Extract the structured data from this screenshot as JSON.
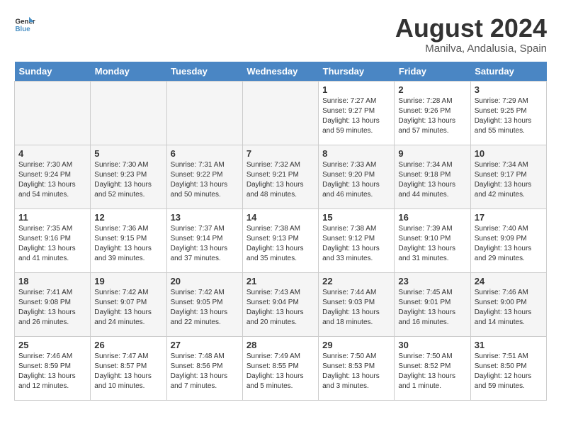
{
  "header": {
    "logo_line1": "General",
    "logo_line2": "Blue",
    "month_year": "August 2024",
    "location": "Manilva, Andalusia, Spain"
  },
  "days_of_week": [
    "Sunday",
    "Monday",
    "Tuesday",
    "Wednesday",
    "Thursday",
    "Friday",
    "Saturday"
  ],
  "weeks": [
    [
      {
        "day": "",
        "detail": ""
      },
      {
        "day": "",
        "detail": ""
      },
      {
        "day": "",
        "detail": ""
      },
      {
        "day": "",
        "detail": ""
      },
      {
        "day": "1",
        "detail": "Sunrise: 7:27 AM\nSunset: 9:27 PM\nDaylight: 13 hours\nand 59 minutes."
      },
      {
        "day": "2",
        "detail": "Sunrise: 7:28 AM\nSunset: 9:26 PM\nDaylight: 13 hours\nand 57 minutes."
      },
      {
        "day": "3",
        "detail": "Sunrise: 7:29 AM\nSunset: 9:25 PM\nDaylight: 13 hours\nand 55 minutes."
      }
    ],
    [
      {
        "day": "4",
        "detail": "Sunrise: 7:30 AM\nSunset: 9:24 PM\nDaylight: 13 hours\nand 54 minutes."
      },
      {
        "day": "5",
        "detail": "Sunrise: 7:30 AM\nSunset: 9:23 PM\nDaylight: 13 hours\nand 52 minutes."
      },
      {
        "day": "6",
        "detail": "Sunrise: 7:31 AM\nSunset: 9:22 PM\nDaylight: 13 hours\nand 50 minutes."
      },
      {
        "day": "7",
        "detail": "Sunrise: 7:32 AM\nSunset: 9:21 PM\nDaylight: 13 hours\nand 48 minutes."
      },
      {
        "day": "8",
        "detail": "Sunrise: 7:33 AM\nSunset: 9:20 PM\nDaylight: 13 hours\nand 46 minutes."
      },
      {
        "day": "9",
        "detail": "Sunrise: 7:34 AM\nSunset: 9:18 PM\nDaylight: 13 hours\nand 44 minutes."
      },
      {
        "day": "10",
        "detail": "Sunrise: 7:34 AM\nSunset: 9:17 PM\nDaylight: 13 hours\nand 42 minutes."
      }
    ],
    [
      {
        "day": "11",
        "detail": "Sunrise: 7:35 AM\nSunset: 9:16 PM\nDaylight: 13 hours\nand 41 minutes."
      },
      {
        "day": "12",
        "detail": "Sunrise: 7:36 AM\nSunset: 9:15 PM\nDaylight: 13 hours\nand 39 minutes."
      },
      {
        "day": "13",
        "detail": "Sunrise: 7:37 AM\nSunset: 9:14 PM\nDaylight: 13 hours\nand 37 minutes."
      },
      {
        "day": "14",
        "detail": "Sunrise: 7:38 AM\nSunset: 9:13 PM\nDaylight: 13 hours\nand 35 minutes."
      },
      {
        "day": "15",
        "detail": "Sunrise: 7:38 AM\nSunset: 9:12 PM\nDaylight: 13 hours\nand 33 minutes."
      },
      {
        "day": "16",
        "detail": "Sunrise: 7:39 AM\nSunset: 9:10 PM\nDaylight: 13 hours\nand 31 minutes."
      },
      {
        "day": "17",
        "detail": "Sunrise: 7:40 AM\nSunset: 9:09 PM\nDaylight: 13 hours\nand 29 minutes."
      }
    ],
    [
      {
        "day": "18",
        "detail": "Sunrise: 7:41 AM\nSunset: 9:08 PM\nDaylight: 13 hours\nand 26 minutes."
      },
      {
        "day": "19",
        "detail": "Sunrise: 7:42 AM\nSunset: 9:07 PM\nDaylight: 13 hours\nand 24 minutes."
      },
      {
        "day": "20",
        "detail": "Sunrise: 7:42 AM\nSunset: 9:05 PM\nDaylight: 13 hours\nand 22 minutes."
      },
      {
        "day": "21",
        "detail": "Sunrise: 7:43 AM\nSunset: 9:04 PM\nDaylight: 13 hours\nand 20 minutes."
      },
      {
        "day": "22",
        "detail": "Sunrise: 7:44 AM\nSunset: 9:03 PM\nDaylight: 13 hours\nand 18 minutes."
      },
      {
        "day": "23",
        "detail": "Sunrise: 7:45 AM\nSunset: 9:01 PM\nDaylight: 13 hours\nand 16 minutes."
      },
      {
        "day": "24",
        "detail": "Sunrise: 7:46 AM\nSunset: 9:00 PM\nDaylight: 13 hours\nand 14 minutes."
      }
    ],
    [
      {
        "day": "25",
        "detail": "Sunrise: 7:46 AM\nSunset: 8:59 PM\nDaylight: 13 hours\nand 12 minutes."
      },
      {
        "day": "26",
        "detail": "Sunrise: 7:47 AM\nSunset: 8:57 PM\nDaylight: 13 hours\nand 10 minutes."
      },
      {
        "day": "27",
        "detail": "Sunrise: 7:48 AM\nSunset: 8:56 PM\nDaylight: 13 hours\nand 7 minutes."
      },
      {
        "day": "28",
        "detail": "Sunrise: 7:49 AM\nSunset: 8:55 PM\nDaylight: 13 hours\nand 5 minutes."
      },
      {
        "day": "29",
        "detail": "Sunrise: 7:50 AM\nSunset: 8:53 PM\nDaylight: 13 hours\nand 3 minutes."
      },
      {
        "day": "30",
        "detail": "Sunrise: 7:50 AM\nSunset: 8:52 PM\nDaylight: 13 hours\nand 1 minute."
      },
      {
        "day": "31",
        "detail": "Sunrise: 7:51 AM\nSunset: 8:50 PM\nDaylight: 12 hours\nand 59 minutes."
      }
    ]
  ]
}
